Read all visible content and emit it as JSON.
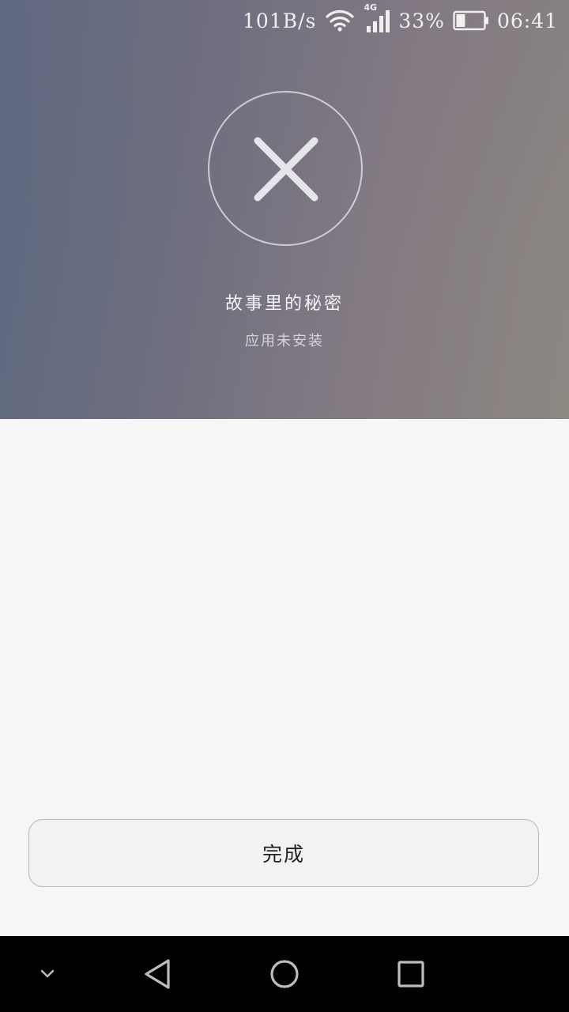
{
  "status_bar": {
    "net_speed": "101B/s",
    "network_type": "4G",
    "battery_percent": "33%",
    "battery_level": 0.33,
    "time": "06:41",
    "icons": [
      "wifi-icon",
      "cellular-signal-icon",
      "battery-icon"
    ]
  },
  "result": {
    "icon": "close-icon",
    "app_name": "故事里的秘密",
    "status": "应用未安装"
  },
  "actions": {
    "done_label": "完成"
  },
  "nav_bar": {
    "icons": [
      "chevron-down-icon",
      "back-icon",
      "home-icon",
      "recents-icon"
    ]
  },
  "colors": {
    "hero_start": "#5b6780",
    "hero_end": "#8d8882",
    "page_background": "#f6f6f6",
    "nav_background": "#000000"
  }
}
